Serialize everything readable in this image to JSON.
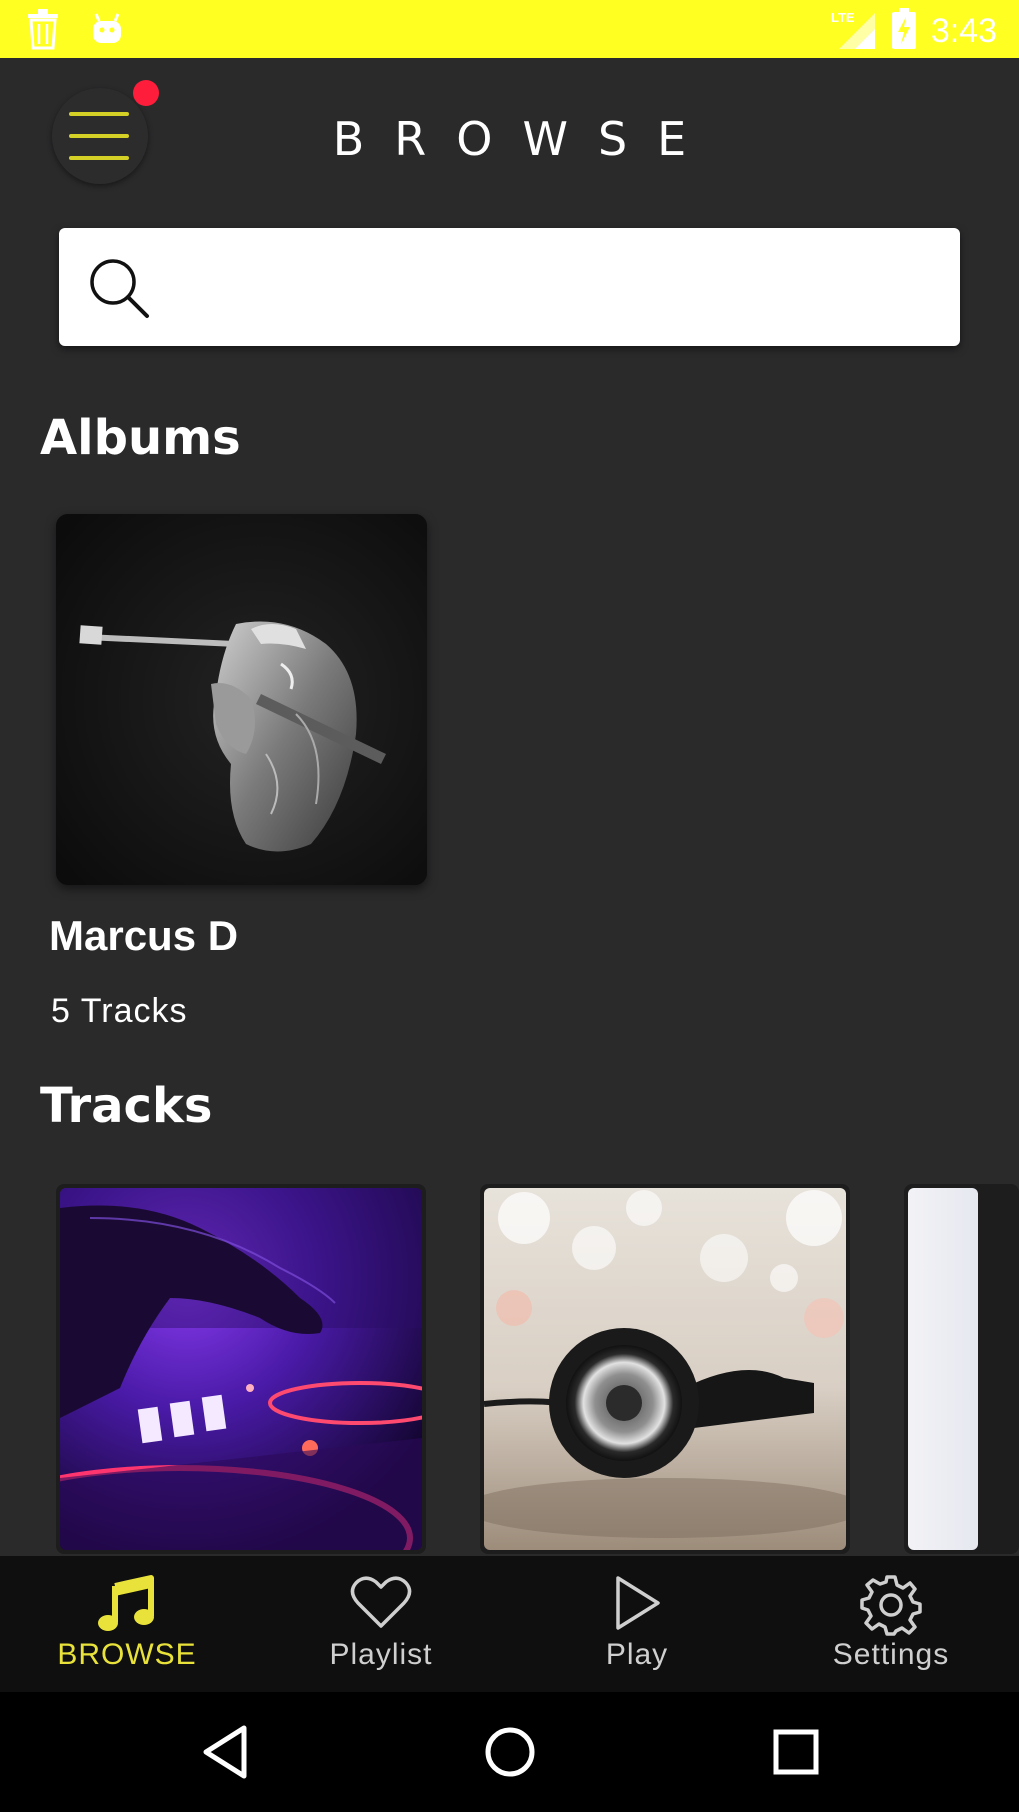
{
  "status_bar": {
    "time": "3:43",
    "network": "LTE",
    "icons": [
      "trash-icon",
      "android-icon",
      "signal-icon",
      "battery-charging-icon"
    ]
  },
  "header": {
    "title": "BROWSE",
    "menu_icon": "hamburger-menu-icon",
    "notification_dot_color": "#ff1d3c"
  },
  "search": {
    "placeholder": "",
    "value": ""
  },
  "albums": {
    "section_title": "Albums",
    "items": [
      {
        "name": "Marcus D",
        "tracks": "5 Tracks",
        "image": "guitarist-bw"
      }
    ]
  },
  "tracks": {
    "section_title": "Tracks",
    "items": [
      {
        "image": "dj-mixer-purple"
      },
      {
        "image": "headphones-bokeh"
      },
      {
        "image": "light-partial"
      }
    ]
  },
  "bottom_nav": {
    "items": [
      {
        "label": "BROWSE",
        "icon": "music-note-icon",
        "active": true
      },
      {
        "label": "Playlist",
        "icon": "heart-icon",
        "active": false
      },
      {
        "label": "Play",
        "icon": "play-icon",
        "active": false
      },
      {
        "label": "Settings",
        "icon": "gear-icon",
        "active": false
      }
    ]
  },
  "colors": {
    "accent": "#e8e23a",
    "status_bar": "#ffff22",
    "background": "#2a2a2b",
    "bottom_nav": "#0f0f10"
  }
}
